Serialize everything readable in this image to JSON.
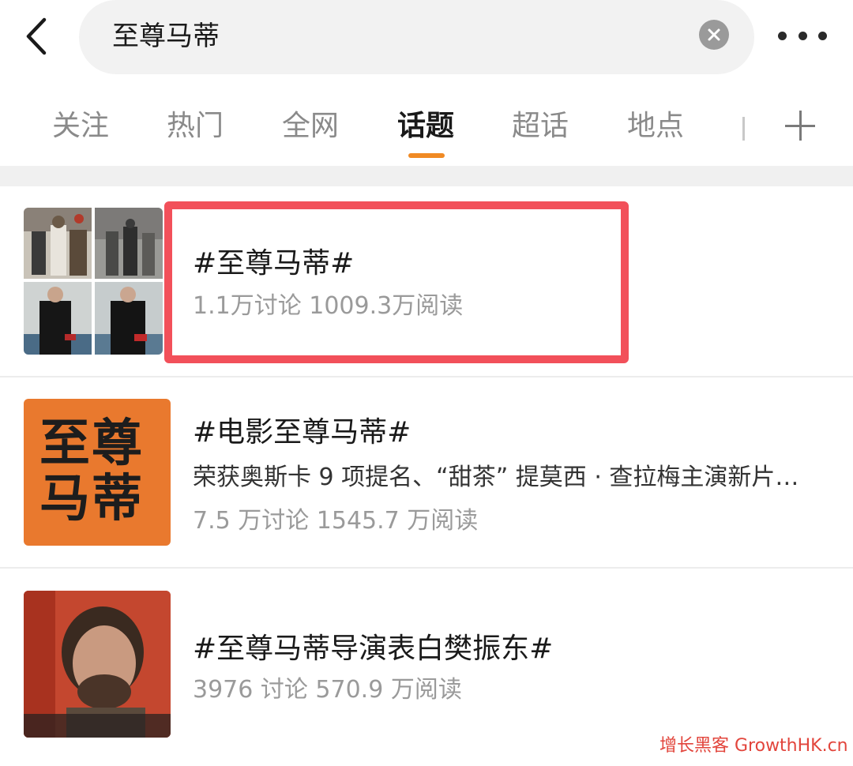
{
  "search": {
    "query": "至尊马蒂"
  },
  "tabs": [
    {
      "label": "关注"
    },
    {
      "label": "热门"
    },
    {
      "label": "全网"
    },
    {
      "label": "话题"
    },
    {
      "label": "超话"
    },
    {
      "label": "地点"
    }
  ],
  "active_tab": "话题",
  "results": [
    {
      "title": "#至尊马蒂#",
      "stats": "1.1万讨论 1009.3万阅读"
    },
    {
      "title": "#电影至尊马蒂#",
      "description": "荣获奥斯卡 9 项提名、“甜茶” 提莫西 · 查拉梅主演新片…",
      "stats": "7.5 万讨论 1545.7 万阅读",
      "poster_text": "至尊马蒂"
    },
    {
      "title": "#至尊马蒂导演表白樊振东#",
      "stats": "3976 讨论 570.9 万阅读"
    }
  ],
  "colors": {
    "accent": "#f08a24",
    "highlight": "#f2505a",
    "poster_orange": "#e9792e"
  },
  "watermark": "增长黑客 GrowthHK.cn"
}
